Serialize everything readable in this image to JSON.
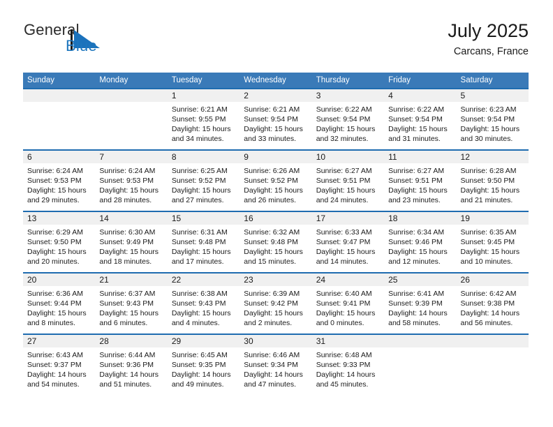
{
  "brand": {
    "name_top": "General",
    "name_bottom": "Blue",
    "mark_icon": "blue-triangle-logo-icon",
    "color_top": "#2b2b2b",
    "color_bottom": "#1e76bd",
    "mark_color": "#1b72bc"
  },
  "header": {
    "title": "July 2025",
    "subtitle": "Carcans, France"
  },
  "colors": {
    "header_row_bg": "#3a7ab8",
    "header_row_text": "#ffffff",
    "week_top_border": "#1f6cb0",
    "day_band_bg": "#f0f0f0",
    "cell_bg": "#ffffff",
    "text": "#1a1a1a"
  },
  "weekdays": [
    "Sunday",
    "Monday",
    "Tuesday",
    "Wednesday",
    "Thursday",
    "Friday",
    "Saturday"
  ],
  "labels": {
    "sunrise_prefix": "Sunrise: ",
    "sunset_prefix": "Sunset: ",
    "daylight_prefix": "Daylight: "
  },
  "weeks": [
    [
      {
        "day": "",
        "sunrise": "",
        "sunset": "",
        "daylight_line1": "",
        "daylight_line2": "",
        "empty": true
      },
      {
        "day": "",
        "sunrise": "",
        "sunset": "",
        "daylight_line1": "",
        "daylight_line2": "",
        "empty": true
      },
      {
        "day": "1",
        "sunrise": "Sunrise: 6:21 AM",
        "sunset": "Sunset: 9:55 PM",
        "daylight_line1": "Daylight: 15 hours",
        "daylight_line2": "and 34 minutes.",
        "empty": false
      },
      {
        "day": "2",
        "sunrise": "Sunrise: 6:21 AM",
        "sunset": "Sunset: 9:54 PM",
        "daylight_line1": "Daylight: 15 hours",
        "daylight_line2": "and 33 minutes.",
        "empty": false
      },
      {
        "day": "3",
        "sunrise": "Sunrise: 6:22 AM",
        "sunset": "Sunset: 9:54 PM",
        "daylight_line1": "Daylight: 15 hours",
        "daylight_line2": "and 32 minutes.",
        "empty": false
      },
      {
        "day": "4",
        "sunrise": "Sunrise: 6:22 AM",
        "sunset": "Sunset: 9:54 PM",
        "daylight_line1": "Daylight: 15 hours",
        "daylight_line2": "and 31 minutes.",
        "empty": false
      },
      {
        "day": "5",
        "sunrise": "Sunrise: 6:23 AM",
        "sunset": "Sunset: 9:54 PM",
        "daylight_line1": "Daylight: 15 hours",
        "daylight_line2": "and 30 minutes.",
        "empty": false
      }
    ],
    [
      {
        "day": "6",
        "sunrise": "Sunrise: 6:24 AM",
        "sunset": "Sunset: 9:53 PM",
        "daylight_line1": "Daylight: 15 hours",
        "daylight_line2": "and 29 minutes.",
        "empty": false
      },
      {
        "day": "7",
        "sunrise": "Sunrise: 6:24 AM",
        "sunset": "Sunset: 9:53 PM",
        "daylight_line1": "Daylight: 15 hours",
        "daylight_line2": "and 28 minutes.",
        "empty": false
      },
      {
        "day": "8",
        "sunrise": "Sunrise: 6:25 AM",
        "sunset": "Sunset: 9:52 PM",
        "daylight_line1": "Daylight: 15 hours",
        "daylight_line2": "and 27 minutes.",
        "empty": false
      },
      {
        "day": "9",
        "sunrise": "Sunrise: 6:26 AM",
        "sunset": "Sunset: 9:52 PM",
        "daylight_line1": "Daylight: 15 hours",
        "daylight_line2": "and 26 minutes.",
        "empty": false
      },
      {
        "day": "10",
        "sunrise": "Sunrise: 6:27 AM",
        "sunset": "Sunset: 9:51 PM",
        "daylight_line1": "Daylight: 15 hours",
        "daylight_line2": "and 24 minutes.",
        "empty": false
      },
      {
        "day": "11",
        "sunrise": "Sunrise: 6:27 AM",
        "sunset": "Sunset: 9:51 PM",
        "daylight_line1": "Daylight: 15 hours",
        "daylight_line2": "and 23 minutes.",
        "empty": false
      },
      {
        "day": "12",
        "sunrise": "Sunrise: 6:28 AM",
        "sunset": "Sunset: 9:50 PM",
        "daylight_line1": "Daylight: 15 hours",
        "daylight_line2": "and 21 minutes.",
        "empty": false
      }
    ],
    [
      {
        "day": "13",
        "sunrise": "Sunrise: 6:29 AM",
        "sunset": "Sunset: 9:50 PM",
        "daylight_line1": "Daylight: 15 hours",
        "daylight_line2": "and 20 minutes.",
        "empty": false
      },
      {
        "day": "14",
        "sunrise": "Sunrise: 6:30 AM",
        "sunset": "Sunset: 9:49 PM",
        "daylight_line1": "Daylight: 15 hours",
        "daylight_line2": "and 18 minutes.",
        "empty": false
      },
      {
        "day": "15",
        "sunrise": "Sunrise: 6:31 AM",
        "sunset": "Sunset: 9:48 PM",
        "daylight_line1": "Daylight: 15 hours",
        "daylight_line2": "and 17 minutes.",
        "empty": false
      },
      {
        "day": "16",
        "sunrise": "Sunrise: 6:32 AM",
        "sunset": "Sunset: 9:48 PM",
        "daylight_line1": "Daylight: 15 hours",
        "daylight_line2": "and 15 minutes.",
        "empty": false
      },
      {
        "day": "17",
        "sunrise": "Sunrise: 6:33 AM",
        "sunset": "Sunset: 9:47 PM",
        "daylight_line1": "Daylight: 15 hours",
        "daylight_line2": "and 14 minutes.",
        "empty": false
      },
      {
        "day": "18",
        "sunrise": "Sunrise: 6:34 AM",
        "sunset": "Sunset: 9:46 PM",
        "daylight_line1": "Daylight: 15 hours",
        "daylight_line2": "and 12 minutes.",
        "empty": false
      },
      {
        "day": "19",
        "sunrise": "Sunrise: 6:35 AM",
        "sunset": "Sunset: 9:45 PM",
        "daylight_line1": "Daylight: 15 hours",
        "daylight_line2": "and 10 minutes.",
        "empty": false
      }
    ],
    [
      {
        "day": "20",
        "sunrise": "Sunrise: 6:36 AM",
        "sunset": "Sunset: 9:44 PM",
        "daylight_line1": "Daylight: 15 hours",
        "daylight_line2": "and 8 minutes.",
        "empty": false
      },
      {
        "day": "21",
        "sunrise": "Sunrise: 6:37 AM",
        "sunset": "Sunset: 9:43 PM",
        "daylight_line1": "Daylight: 15 hours",
        "daylight_line2": "and 6 minutes.",
        "empty": false
      },
      {
        "day": "22",
        "sunrise": "Sunrise: 6:38 AM",
        "sunset": "Sunset: 9:43 PM",
        "daylight_line1": "Daylight: 15 hours",
        "daylight_line2": "and 4 minutes.",
        "empty": false
      },
      {
        "day": "23",
        "sunrise": "Sunrise: 6:39 AM",
        "sunset": "Sunset: 9:42 PM",
        "daylight_line1": "Daylight: 15 hours",
        "daylight_line2": "and 2 minutes.",
        "empty": false
      },
      {
        "day": "24",
        "sunrise": "Sunrise: 6:40 AM",
        "sunset": "Sunset: 9:41 PM",
        "daylight_line1": "Daylight: 15 hours",
        "daylight_line2": "and 0 minutes.",
        "empty": false
      },
      {
        "day": "25",
        "sunrise": "Sunrise: 6:41 AM",
        "sunset": "Sunset: 9:39 PM",
        "daylight_line1": "Daylight: 14 hours",
        "daylight_line2": "and 58 minutes.",
        "empty": false
      },
      {
        "day": "26",
        "sunrise": "Sunrise: 6:42 AM",
        "sunset": "Sunset: 9:38 PM",
        "daylight_line1": "Daylight: 14 hours",
        "daylight_line2": "and 56 minutes.",
        "empty": false
      }
    ],
    [
      {
        "day": "27",
        "sunrise": "Sunrise: 6:43 AM",
        "sunset": "Sunset: 9:37 PM",
        "daylight_line1": "Daylight: 14 hours",
        "daylight_line2": "and 54 minutes.",
        "empty": false
      },
      {
        "day": "28",
        "sunrise": "Sunrise: 6:44 AM",
        "sunset": "Sunset: 9:36 PM",
        "daylight_line1": "Daylight: 14 hours",
        "daylight_line2": "and 51 minutes.",
        "empty": false
      },
      {
        "day": "29",
        "sunrise": "Sunrise: 6:45 AM",
        "sunset": "Sunset: 9:35 PM",
        "daylight_line1": "Daylight: 14 hours",
        "daylight_line2": "and 49 minutes.",
        "empty": false
      },
      {
        "day": "30",
        "sunrise": "Sunrise: 6:46 AM",
        "sunset": "Sunset: 9:34 PM",
        "daylight_line1": "Daylight: 14 hours",
        "daylight_line2": "and 47 minutes.",
        "empty": false
      },
      {
        "day": "31",
        "sunrise": "Sunrise: 6:48 AM",
        "sunset": "Sunset: 9:33 PM",
        "daylight_line1": "Daylight: 14 hours",
        "daylight_line2": "and 45 minutes.",
        "empty": false
      },
      {
        "day": "",
        "sunrise": "",
        "sunset": "",
        "daylight_line1": "",
        "daylight_line2": "",
        "empty": true
      },
      {
        "day": "",
        "sunrise": "",
        "sunset": "",
        "daylight_line1": "",
        "daylight_line2": "",
        "empty": true
      }
    ]
  ]
}
